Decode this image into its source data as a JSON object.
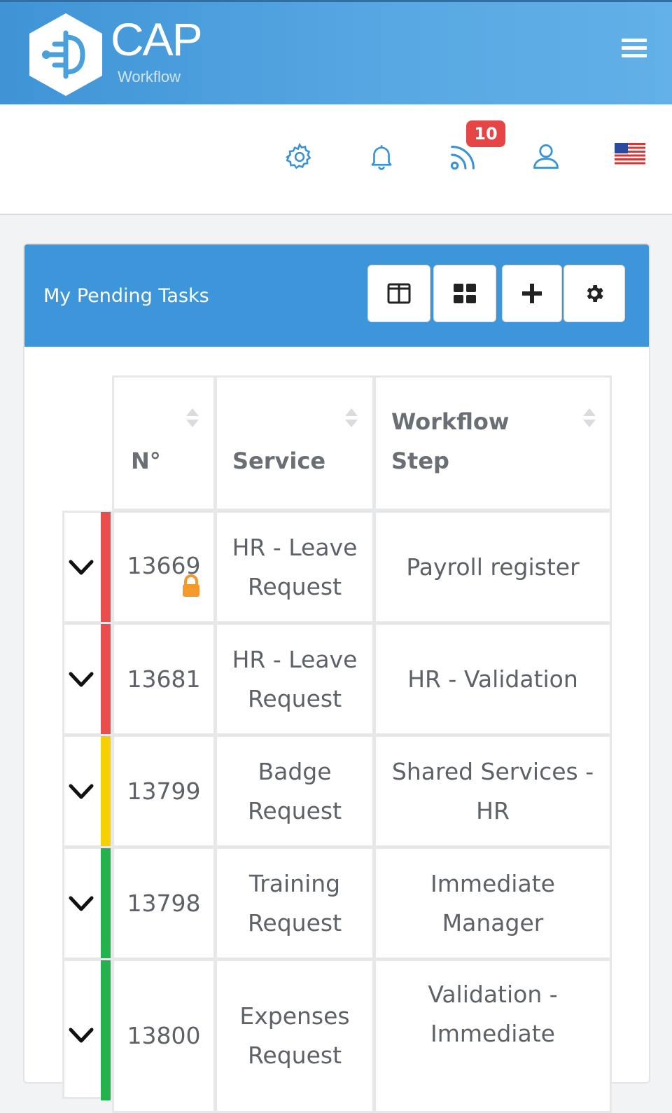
{
  "header": {
    "logo_title": "CAP",
    "logo_subtitle": "Workflow"
  },
  "icons": {
    "settings": "gear-icon",
    "notifications": "bell-icon",
    "feed": "rss-icon",
    "user": "user-icon",
    "language": "us-flag-icon",
    "feed_badge": "10"
  },
  "panel": {
    "title": "My Pending Tasks",
    "tools": [
      "split-view-icon",
      "grid-icon",
      "plus-icon",
      "gear-icon"
    ]
  },
  "table": {
    "headers": {
      "number": "N°",
      "service": "Service",
      "step_line1": "Workflow",
      "step_line2": "Step"
    },
    "rows": [
      {
        "number": "13669",
        "service_l1": "HR - Leave",
        "service_l2": "Request",
        "step_l1": "Payroll register",
        "step_l2": "",
        "priority": "red",
        "locked": true
      },
      {
        "number": "13681",
        "service_l1": "HR - Leave",
        "service_l2": "Request",
        "step_l1": "HR - Validation",
        "step_l2": "",
        "priority": "red",
        "locked": false
      },
      {
        "number": "13799",
        "service_l1": "Badge",
        "service_l2": "Request",
        "step_l1": "Shared Services -",
        "step_l2": "HR",
        "priority": "yellow",
        "locked": false
      },
      {
        "number": "13798",
        "service_l1": "Training",
        "service_l2": "Request",
        "step_l1": "Immediate",
        "step_l2": "Manager",
        "priority": "green",
        "locked": false
      },
      {
        "number": "13800",
        "service_l1": "Expenses",
        "service_l2": "Request",
        "step_l1": "Validation -",
        "step_l2": "Immediate",
        "priority": "green",
        "locked": false
      }
    ]
  },
  "colors": {
    "header_blue": "#4aa0dd",
    "panel_blue": "#3d96d9",
    "priority_red": "#e84c4c",
    "priority_yellow": "#f5d000",
    "priority_green": "#22b14c",
    "badge_red": "#e64545",
    "lock_orange": "#f59a2a"
  }
}
